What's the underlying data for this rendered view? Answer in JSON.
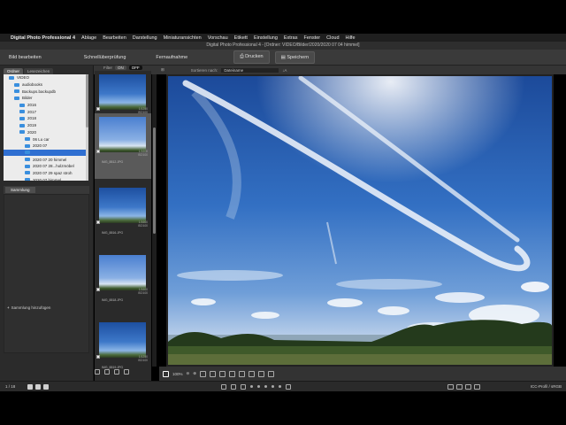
{
  "menubar": {
    "app_name": "Digital Photo Professional 4",
    "items": [
      "Ablage",
      "Bearbeiten",
      "Darstellung",
      "Miniaturansichten",
      "Vorschau",
      "Etikett",
      "Einstellung",
      "Extras",
      "Fenster",
      "Cloud",
      "Hilfe"
    ]
  },
  "window_title": "Digital Photo Professional 4 - [Ordner: VIDEO/Bilder/2020/2020 07 04 himmel]",
  "toolbar": {
    "edit_image": "Bild bearbeiten",
    "quick_check": "Schnellüberprüfung",
    "remote": "Fernaufnahme",
    "print": "Drucken",
    "save": "Speichern"
  },
  "subbar": {
    "filter_label": "Filter",
    "filter_on": "ON",
    "filter_off": "OFF",
    "sort_label": "Sortieren nach:",
    "sort_value": "Dateiname"
  },
  "left_panel": {
    "tabs": [
      "Ordner",
      "Lesezeichen"
    ],
    "tree": [
      {
        "label": "VIDEO",
        "indent": 1,
        "selected": false
      },
      {
        "label": "audiobooks",
        "indent": 2,
        "selected": false
      },
      {
        "label": "Backups.backupdb",
        "indent": 2,
        "selected": false
      },
      {
        "label": "Bilder",
        "indent": 2,
        "selected": false
      },
      {
        "label": "2016",
        "indent": 3,
        "selected": false
      },
      {
        "label": "2017",
        "indent": 3,
        "selected": false
      },
      {
        "label": "2018",
        "indent": 3,
        "selected": false
      },
      {
        "label": "2019",
        "indent": 3,
        "selected": false
      },
      {
        "label": "2020",
        "indent": 3,
        "selected": false
      },
      {
        "label": "06 Lu car",
        "indent": 4,
        "selected": false
      },
      {
        "label": "2020 07",
        "indent": 4,
        "selected": false
      },
      {
        "label": "",
        "indent": 4,
        "selected": true
      },
      {
        "label": "2020 07 20 himmel",
        "indent": 4,
        "selected": false
      },
      {
        "label": "2020 07 28...holzmöbel",
        "indent": 4,
        "selected": false
      },
      {
        "label": "2020 07 29 spaz stroh",
        "indent": 4,
        "selected": false
      },
      {
        "label": "2020 07 himmel",
        "indent": 4,
        "selected": false
      },
      {
        "label": "2020 08 04 lu",
        "indent": 4,
        "selected": false
      }
    ],
    "collection_tab": "Sammlung",
    "add_collection": "Sammlung hinzufügen"
  },
  "filmstrip": {
    "thumbnails": [
      {
        "name": "",
        "meta": "1/1250\nISO100",
        "selected": false
      },
      {
        "name": "IMG_8812.JPG",
        "meta": "1/1600\nISO100",
        "selected": true
      },
      {
        "name": "IMG_8816.JPG",
        "meta": "1/1600\nISO100",
        "selected": false
      },
      {
        "name": "IMG_8818.JPG",
        "meta": "1/1600\nISO100",
        "selected": false
      },
      {
        "name": "IMG_8819.JPG",
        "meta": "1/1250\nISO100",
        "selected": false
      }
    ]
  },
  "bottom": {
    "zoom": "100%"
  },
  "status": {
    "count": "1 / 18",
    "icc": "ICC-Profil / sRGB"
  }
}
